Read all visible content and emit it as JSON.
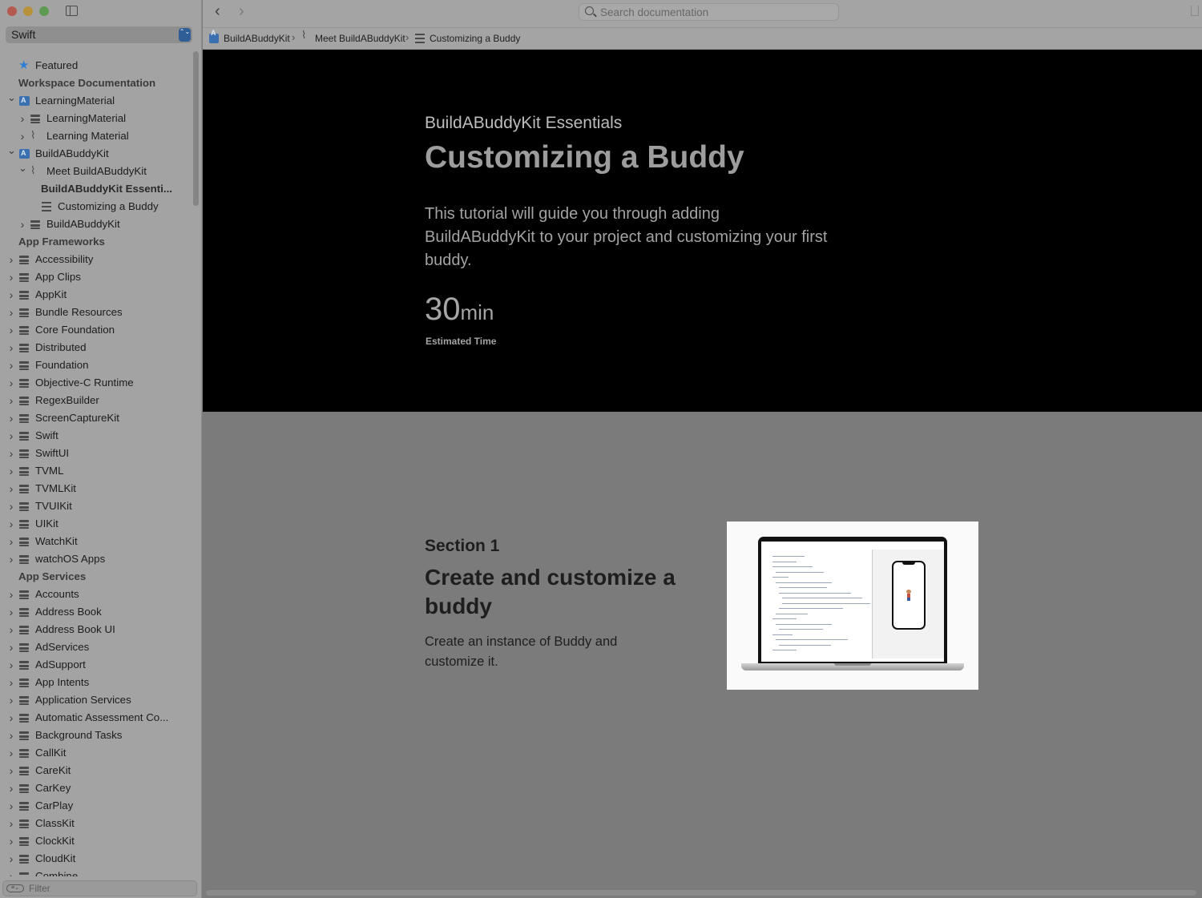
{
  "window": {
    "language_selector": {
      "value": "Swift",
      "stepper_glyph": "⌃⌄"
    },
    "filter_placeholder": "Filter"
  },
  "sidebar": {
    "items": [
      {
        "label": "Featured",
        "kind": "featured",
        "level": 0,
        "expand": "none",
        "icon": "star-icon"
      },
      {
        "label": "Workspace Documentation",
        "kind": "header",
        "level": 0
      },
      {
        "label": "LearningMaterial",
        "kind": "item",
        "level": 0,
        "expand": "open",
        "icon": "app-icon"
      },
      {
        "label": "LearningMaterial",
        "kind": "item",
        "level": 1,
        "expand": "closed",
        "icon": "stack-icon"
      },
      {
        "label": "Learning Material",
        "kind": "item",
        "level": 1,
        "expand": "closed",
        "icon": "path-icon"
      },
      {
        "label": "BuildABuddyKit",
        "kind": "item",
        "level": 0,
        "expand": "open",
        "icon": "app-icon"
      },
      {
        "label": "Meet BuildABuddyKit",
        "kind": "item",
        "level": 1,
        "expand": "open",
        "icon": "path-icon"
      },
      {
        "label": "BuildABuddyKit Essenti...",
        "kind": "bold",
        "level": 2,
        "expand": "none",
        "icon": ""
      },
      {
        "label": "Customizing a Buddy",
        "kind": "item",
        "level": 2,
        "expand": "none",
        "icon": "list-icon"
      },
      {
        "label": "BuildABuddyKit",
        "kind": "item",
        "level": 1,
        "expand": "closed",
        "icon": "stack-icon"
      },
      {
        "label": "App Frameworks",
        "kind": "header",
        "level": 0
      },
      {
        "label": "Accessibility",
        "kind": "item",
        "level": 0,
        "expand": "closed",
        "icon": "stack-icon"
      },
      {
        "label": "App Clips",
        "kind": "item",
        "level": 0,
        "expand": "closed",
        "icon": "stack-icon"
      },
      {
        "label": "AppKit",
        "kind": "item",
        "level": 0,
        "expand": "closed",
        "icon": "stack-icon"
      },
      {
        "label": "Bundle Resources",
        "kind": "item",
        "level": 0,
        "expand": "closed",
        "icon": "stack-icon"
      },
      {
        "label": "Core Foundation",
        "kind": "item",
        "level": 0,
        "expand": "closed",
        "icon": "stack-icon"
      },
      {
        "label": "Distributed",
        "kind": "item",
        "level": 0,
        "expand": "closed",
        "icon": "stack-icon"
      },
      {
        "label": "Foundation",
        "kind": "item",
        "level": 0,
        "expand": "closed",
        "icon": "stack-icon"
      },
      {
        "label": "Objective-C Runtime",
        "kind": "item",
        "level": 0,
        "expand": "closed",
        "icon": "stack-icon"
      },
      {
        "label": "RegexBuilder",
        "kind": "item",
        "level": 0,
        "expand": "closed",
        "icon": "stack-icon"
      },
      {
        "label": "ScreenCaptureKit",
        "kind": "item",
        "level": 0,
        "expand": "closed",
        "icon": "stack-icon"
      },
      {
        "label": "Swift",
        "kind": "item",
        "level": 0,
        "expand": "closed",
        "icon": "stack-icon"
      },
      {
        "label": "SwiftUI",
        "kind": "item",
        "level": 0,
        "expand": "closed",
        "icon": "stack-icon"
      },
      {
        "label": "TVML",
        "kind": "item",
        "level": 0,
        "expand": "closed",
        "icon": "stack-icon"
      },
      {
        "label": "TVMLKit",
        "kind": "item",
        "level": 0,
        "expand": "closed",
        "icon": "stack-icon"
      },
      {
        "label": "TVUIKit",
        "kind": "item",
        "level": 0,
        "expand": "closed",
        "icon": "stack-icon"
      },
      {
        "label": "UIKit",
        "kind": "item",
        "level": 0,
        "expand": "closed",
        "icon": "stack-icon"
      },
      {
        "label": "WatchKit",
        "kind": "item",
        "level": 0,
        "expand": "closed",
        "icon": "stack-icon"
      },
      {
        "label": "watchOS Apps",
        "kind": "item",
        "level": 0,
        "expand": "closed",
        "icon": "stack-icon"
      },
      {
        "label": "App Services",
        "kind": "header",
        "level": 0
      },
      {
        "label": "Accounts",
        "kind": "item",
        "level": 0,
        "expand": "closed",
        "icon": "stack-icon"
      },
      {
        "label": "Address Book",
        "kind": "item",
        "level": 0,
        "expand": "closed",
        "icon": "stack-icon"
      },
      {
        "label": "Address Book UI",
        "kind": "item",
        "level": 0,
        "expand": "closed",
        "icon": "stack-icon"
      },
      {
        "label": "AdServices",
        "kind": "item",
        "level": 0,
        "expand": "closed",
        "icon": "stack-icon"
      },
      {
        "label": "AdSupport",
        "kind": "item",
        "level": 0,
        "expand": "closed",
        "icon": "stack-icon"
      },
      {
        "label": "App Intents",
        "kind": "item",
        "level": 0,
        "expand": "closed",
        "icon": "stack-icon"
      },
      {
        "label": "Application Services",
        "kind": "item",
        "level": 0,
        "expand": "closed",
        "icon": "stack-icon"
      },
      {
        "label": "Automatic Assessment Co...",
        "kind": "item",
        "level": 0,
        "expand": "closed",
        "icon": "stack-icon"
      },
      {
        "label": "Background Tasks",
        "kind": "item",
        "level": 0,
        "expand": "closed",
        "icon": "stack-icon"
      },
      {
        "label": "CallKit",
        "kind": "item",
        "level": 0,
        "expand": "closed",
        "icon": "stack-icon"
      },
      {
        "label": "CareKit",
        "kind": "item",
        "level": 0,
        "expand": "closed",
        "icon": "stack-icon"
      },
      {
        "label": "CarKey",
        "kind": "item",
        "level": 0,
        "expand": "closed",
        "icon": "stack-icon"
      },
      {
        "label": "CarPlay",
        "kind": "item",
        "level": 0,
        "expand": "closed",
        "icon": "stack-icon"
      },
      {
        "label": "ClassKit",
        "kind": "item",
        "level": 0,
        "expand": "closed",
        "icon": "stack-icon"
      },
      {
        "label": "ClockKit",
        "kind": "item",
        "level": 0,
        "expand": "closed",
        "icon": "stack-icon"
      },
      {
        "label": "CloudKit",
        "kind": "item",
        "level": 0,
        "expand": "closed",
        "icon": "stack-icon"
      },
      {
        "label": "Combine",
        "kind": "item",
        "level": 0,
        "expand": "closed",
        "icon": "stack-icon"
      }
    ]
  },
  "toolbar": {
    "back_glyph": "‹",
    "forward_glyph": "›",
    "search_placeholder": "Search documentation"
  },
  "breadcrumb": {
    "separator": "›",
    "items": [
      {
        "label": "BuildABuddyKit",
        "icon": "app-icon"
      },
      {
        "label": "Meet BuildABuddyKit",
        "icon": "path-icon"
      },
      {
        "label": "Customizing a Buddy",
        "icon": "list-icon"
      }
    ]
  },
  "hero": {
    "eyebrow": "BuildABuddyKit Essentials",
    "title": "Customizing a Buddy",
    "abstract": "This tutorial will guide you through adding BuildABuddyKit to your project and customizing your first buddy.",
    "time_value": "30",
    "time_unit": "min",
    "time_label": "Estimated Time"
  },
  "section1": {
    "number": "Section 1",
    "title": "Create and customize a buddy",
    "description": "Create an instance of Buddy and customize it."
  }
}
